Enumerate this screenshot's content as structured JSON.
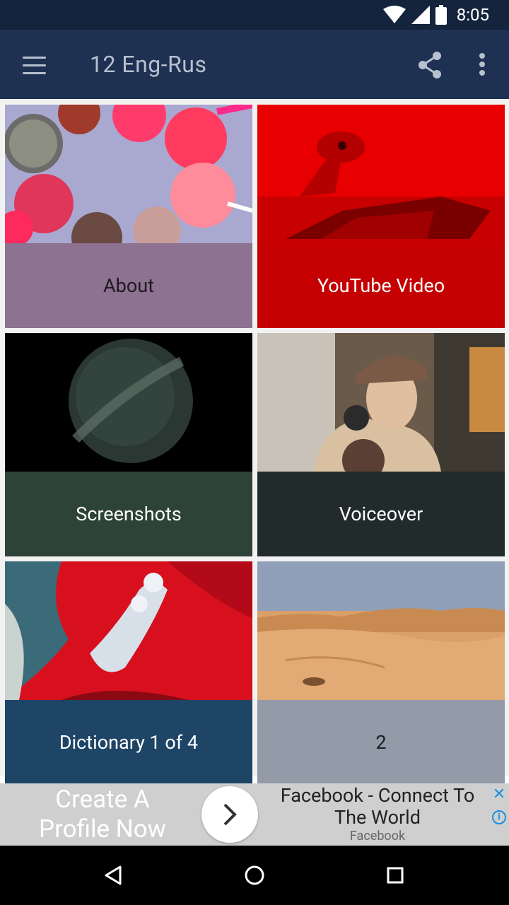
{
  "status_bar": {
    "time": "8:05"
  },
  "app_bar": {
    "title": "12 Eng-Rus"
  },
  "tiles": [
    {
      "label": "About",
      "label_bg": "#8e7291",
      "label_color": "#1f1a22"
    },
    {
      "label": "YouTube Video",
      "label_bg": "#c40000",
      "label_color": "#ffffff"
    },
    {
      "label": "Screenshots",
      "label_bg": "#2d4337",
      "label_color": "#ffffff"
    },
    {
      "label": "Voiceover",
      "label_bg": "#212b2b",
      "label_color": "#ffffff"
    },
    {
      "label": "Dictionary 1 of 4",
      "label_bg": "#1e4466",
      "label_color": "#ffffff"
    },
    {
      "label": "2",
      "label_bg": "#939aa8",
      "label_color": "#1d1f25"
    }
  ],
  "ad": {
    "left_text": "Create A Profile Now",
    "title": "Facebook - Connect To The World",
    "subtitle": "Facebook"
  },
  "icons": {
    "menu": "hamburger-icon",
    "share": "share-icon",
    "more": "more-vert-icon",
    "wifi": "wifi-icon",
    "signal": "signal-icon",
    "battery": "battery-icon",
    "back": "back-triangle-icon",
    "home": "home-circle-icon",
    "recents": "recents-square-icon"
  }
}
